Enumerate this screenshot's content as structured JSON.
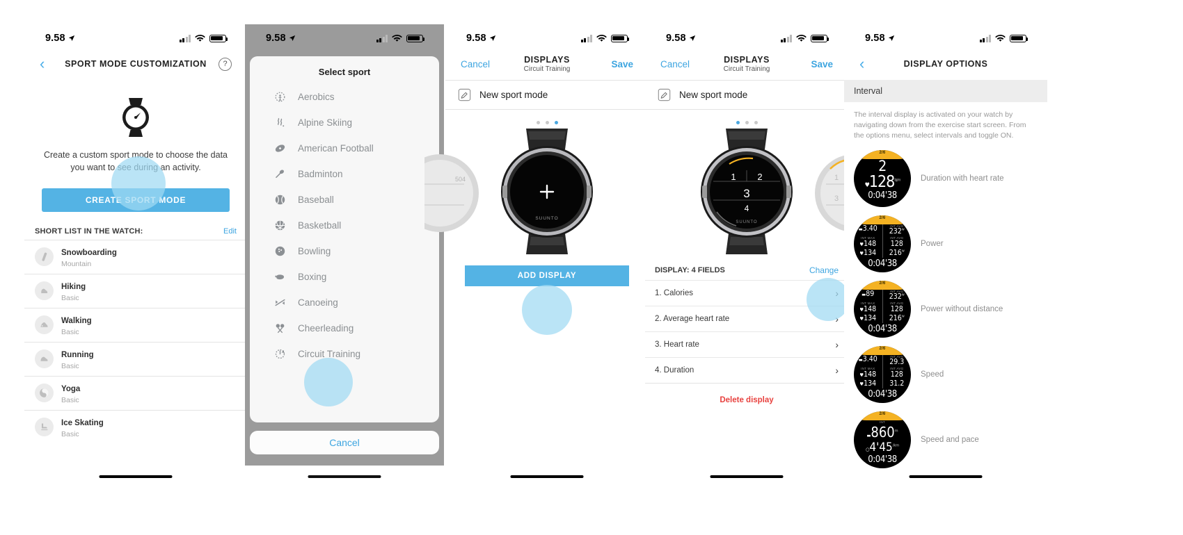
{
  "status_bar": {
    "time": "9.58"
  },
  "panel1": {
    "nav": {
      "back_icon": "chevron-left-icon",
      "title": "SPORT MODE CUSTOMIZATION",
      "help_icon": "question-mark-icon"
    },
    "hero_icon": "watch-icon",
    "description": "Create a custom sport mode to choose the data you want to see during an activity.",
    "cta_label": "CREATE SPORT MODE",
    "section_label": "SHORT LIST IN THE WATCH:",
    "edit_label": "Edit",
    "sports": [
      {
        "name": "Snowboarding",
        "sub": "Mountain",
        "icon": "snowboard-icon"
      },
      {
        "name": "Hiking",
        "sub": "Basic",
        "icon": "hiking-boot-icon"
      },
      {
        "name": "Walking",
        "sub": "Basic",
        "icon": "walking-shoe-icon"
      },
      {
        "name": "Running",
        "sub": "Basic",
        "icon": "running-shoe-icon"
      },
      {
        "name": "Yoga",
        "sub": "Basic",
        "icon": "yin-yang-icon"
      },
      {
        "name": "Ice Skating",
        "sub": "Basic",
        "icon": "ice-skate-icon"
      }
    ]
  },
  "panel2": {
    "sheet_title": "Select sport",
    "cancel_label": "Cancel",
    "sports": [
      {
        "name": "Aerobics",
        "icon": "aerobics-icon"
      },
      {
        "name": "Alpine Skiing",
        "icon": "alpine-skiing-icon"
      },
      {
        "name": "American Football",
        "icon": "american-football-icon"
      },
      {
        "name": "Badminton",
        "icon": "badminton-icon"
      },
      {
        "name": "Baseball",
        "icon": "baseball-icon"
      },
      {
        "name": "Basketball",
        "icon": "basketball-icon"
      },
      {
        "name": "Bowling",
        "icon": "bowling-icon"
      },
      {
        "name": "Boxing",
        "icon": "boxing-glove-icon"
      },
      {
        "name": "Canoeing",
        "icon": "canoeing-icon"
      },
      {
        "name": "Cheerleading",
        "icon": "cheerleading-icon"
      },
      {
        "name": "Circuit Training",
        "icon": "circuit-training-icon"
      }
    ]
  },
  "panel3": {
    "nav": {
      "cancel": "Cancel",
      "title": "DISPLAYS",
      "subtitle": "Circuit Training",
      "save": "Save"
    },
    "mode_name": "New sport mode",
    "mode_icon": "pencil-edit-icon",
    "pager": {
      "count": 3,
      "active": 3
    },
    "watch_center_glyph": "+",
    "watch_brand": "SUUNTO",
    "add_display_label": "ADD DISPLAY"
  },
  "panel4": {
    "nav": {
      "cancel": "Cancel",
      "title": "DISPLAYS",
      "subtitle": "Circuit Training",
      "save": "Save"
    },
    "mode_name": "New sport mode",
    "mode_icon": "pencil-edit-icon",
    "pager": {
      "count": 3,
      "active": 1
    },
    "watch_fields": [
      "1",
      "2",
      "3",
      "4"
    ],
    "watch_brand": "SUUNTO",
    "display_header": "DISPLAY: 4 FIELDS",
    "change_label": "Change",
    "fields": [
      "1. Calories",
      "2. Average heart rate",
      "3. Heart rate",
      "4. Duration"
    ],
    "delete_label": "Delete display"
  },
  "panel5": {
    "nav": {
      "back_icon": "chevron-left-icon",
      "title": "DISPLAY OPTIONS"
    },
    "selected_option": "Interval",
    "description": "The interval display is activated on your watch by navigating down from the exercise start screen. From the options menu, select intervals and toggle ON.",
    "options": [
      {
        "label": "Duration with heart rate",
        "face": {
          "arc": "2/6",
          "type": "big",
          "big": "2",
          "hr": "128",
          "hr_unit": "bpm",
          "time": "0:04'38"
        }
      },
      {
        "label": "Power",
        "face": {
          "arc": "2/6",
          "type": "grid",
          "rows": [
            {
              "l_cap": "",
              "l": "3.40",
              "r_cap": "INT AVG",
              "r": "232",
              "r_unit": "w"
            },
            {
              "l_cap": "INT MAX",
              "l": "148",
              "r_cap": "INT AVG",
              "r": "128",
              "r_unit": ""
            },
            {
              "l_cap": "",
              "l": "134",
              "r_cap": "",
              "r": "216",
              "r_unit": "w"
            }
          ],
          "time": "0:04'38"
        }
      },
      {
        "label": "Power without distance",
        "face": {
          "arc": "2/6",
          "type": "grid",
          "rows": [
            {
              "l_cap": "",
              "l": "89",
              "r_cap": "INT AVG",
              "r": "232",
              "r_unit": "w"
            },
            {
              "l_cap": "INT MAX",
              "l": "148",
              "r_cap": "INT AVG",
              "r": "128",
              "r_unit": ""
            },
            {
              "l_cap": "",
              "l": "134",
              "r_cap": "",
              "r": "216",
              "r_unit": "w"
            }
          ],
          "time": "0:04'38"
        }
      },
      {
        "label": "Speed",
        "face": {
          "arc": "2/6",
          "type": "grid",
          "rows": [
            {
              "l_cap": "",
              "l": "3.40",
              "r_cap": "INT AVG",
              "r": "29.3",
              "r_unit": ""
            },
            {
              "l_cap": "INT MAX",
              "l": "148",
              "r_cap": "INT AVG",
              "r": "128",
              "r_unit": ""
            },
            {
              "l_cap": "",
              "l": "134",
              "r_cap": "",
              "r": "31.2",
              "r_unit": ""
            }
          ],
          "time": "0:04'38"
        }
      },
      {
        "label": "Speed and pace",
        "face": {
          "arc": "2/6",
          "type": "pace",
          "cap": "INT",
          "big": "860",
          "big_unit": "m",
          "second": "4'45",
          "second_unit": "/km",
          "time": "0:04'38"
        }
      }
    ]
  },
  "colors": {
    "accent_blue": "#3da5e0",
    "button_blue": "#54b3e4",
    "tap_highlight": "#9fd9f2",
    "delete_red": "#e8423f",
    "watch_yellow": "#f4b223"
  }
}
